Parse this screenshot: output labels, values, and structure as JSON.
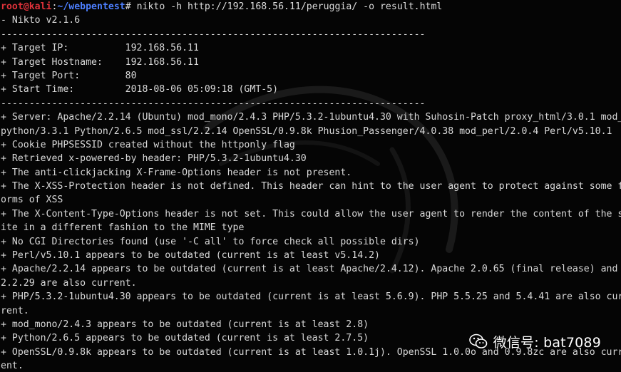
{
  "colors": {
    "background": "#050505",
    "text": "#d9d9d9",
    "prompt_user": "#e0323a",
    "prompt_path": "#4d7fff"
  },
  "prompt": {
    "user_host": "root@kali",
    "separator": ":",
    "path": "~/webpentest",
    "symbol": "#",
    "command": " nikto -h http://192.168.56.11/peruggia/ -o result.html"
  },
  "output": [
    "- Nikto v2.1.6",
    "---------------------------------------------------------------------------",
    "+ Target IP:          192.168.56.11",
    "+ Target Hostname:    192.168.56.11",
    "+ Target Port:        80",
    "+ Start Time:         2018-08-06 05:09:18 (GMT-5)",
    "---------------------------------------------------------------------------",
    "+ Server: Apache/2.2.14 (Ubuntu) mod_mono/2.4.3 PHP/5.3.2-1ubuntu4.30 with Suhosin-Patch proxy_html/3.0.1 mod_",
    "python/3.3.1 Python/2.6.5 mod_ssl/2.2.14 OpenSSL/0.9.8k Phusion_Passenger/4.0.38 mod_perl/2.0.4 Perl/v5.10.1",
    "+ Cookie PHPSESSID created without the httponly flag",
    "+ Retrieved x-powered-by header: PHP/5.3.2-1ubuntu4.30",
    "+ The anti-clickjacking X-Frame-Options header is not present.",
    "+ The X-XSS-Protection header is not defined. This header can hint to the user agent to protect against some f",
    "orms of XSS",
    "+ The X-Content-Type-Options header is not set. This could allow the user agent to render the content of the s",
    "ite in a different fashion to the MIME type",
    "+ No CGI Directories found (use '-C all' to force check all possible dirs)",
    "+ Perl/v5.10.1 appears to be outdated (current is at least v5.14.2)",
    "+ Apache/2.2.14 appears to be outdated (current is at least Apache/2.4.12). Apache 2.0.65 (final release) and",
    "2.2.29 are also current.",
    "+ PHP/5.3.2-1ubuntu4.30 appears to be outdated (current is at least 5.6.9). PHP 5.5.25 and 5.4.41 are also cur",
    "rent.",
    "+ mod_mono/2.4.3 appears to be outdated (current is at least 2.8)",
    "+ Python/2.6.5 appears to be outdated (current is at least 2.7.5)",
    "+ OpenSSL/0.9.8k appears to be outdated (current is at least 1.0.1j). OpenSSL 1.0.0o and 0.9.8zc are also curr",
    "ent."
  ],
  "watermark": {
    "icon": "wechat-icon",
    "text": "微信号: bat7089"
  }
}
